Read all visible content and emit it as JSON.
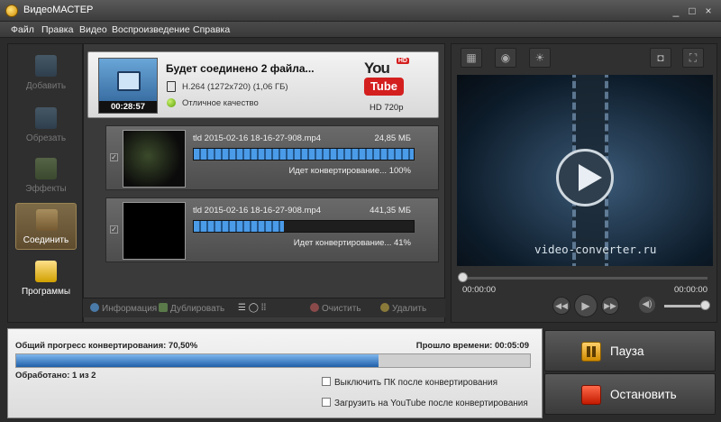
{
  "window": {
    "title": "ВидеоМАСТЕР",
    "controls": [
      "_",
      "□",
      "×"
    ]
  },
  "menu": [
    "Файл",
    "Правка",
    "Видео",
    "Воспроизведение",
    "Справка"
  ],
  "sidebar": [
    {
      "label": "Добавить",
      "icon": "add-video-icon"
    },
    {
      "label": "Обрезать",
      "icon": "cut-video-icon"
    },
    {
      "label": "Эффекты",
      "icon": "effects-icon"
    },
    {
      "label": "Соединить",
      "icon": "join-icon"
    },
    {
      "label": "Программы",
      "icon": "programs-icon"
    }
  ],
  "job": {
    "title": "Будет соединено 2 файла...",
    "duration": "00:28:57",
    "codec": "H.264 (1272x720) (1,06 ГБ)",
    "quality": "Отличное качество",
    "format": {
      "you": "You",
      "tube": "Tube",
      "hd": "HD",
      "label": "HD 720p"
    }
  },
  "files": [
    {
      "name": "tld 2015-02-16 18-16-27-908.mp4",
      "size": "24,85 МБ",
      "status": "Идет конвертирование... 100%",
      "progress": 1.0,
      "checked": true
    },
    {
      "name": "tld 2015-02-16 18-16-27-908.mp4",
      "size": "441,35 МБ",
      "status": "Идет конвертирование... 41%",
      "progress": 0.41,
      "checked": true
    }
  ],
  "toolbar": {
    "info": "Информация",
    "duplicate": "Дублировать",
    "clear": "Очистить",
    "delete": "Удалить"
  },
  "preview": {
    "watermark": "video-converter.ru",
    "time_start": "00:00:00",
    "time_end": "00:00:00",
    "scrub": 0.0,
    "volume": 1.0
  },
  "progress": {
    "label": "Общий прогресс конвертирования: 70,50%",
    "value": 0.705,
    "elapsed": "Прошло времени: 00:05:09",
    "processed": "Обработано: 1 из 2",
    "option_shutdown": "Выключить ПК после конвертирования",
    "option_youtube": "Загрузить на YouTube после конвертирования"
  },
  "actions": {
    "pause": "Пауза",
    "stop": "Остановить"
  },
  "colors": {
    "accent": "#2f7fd0",
    "active_tab": "#7d6a47",
    "stop": "#e23a1a"
  }
}
